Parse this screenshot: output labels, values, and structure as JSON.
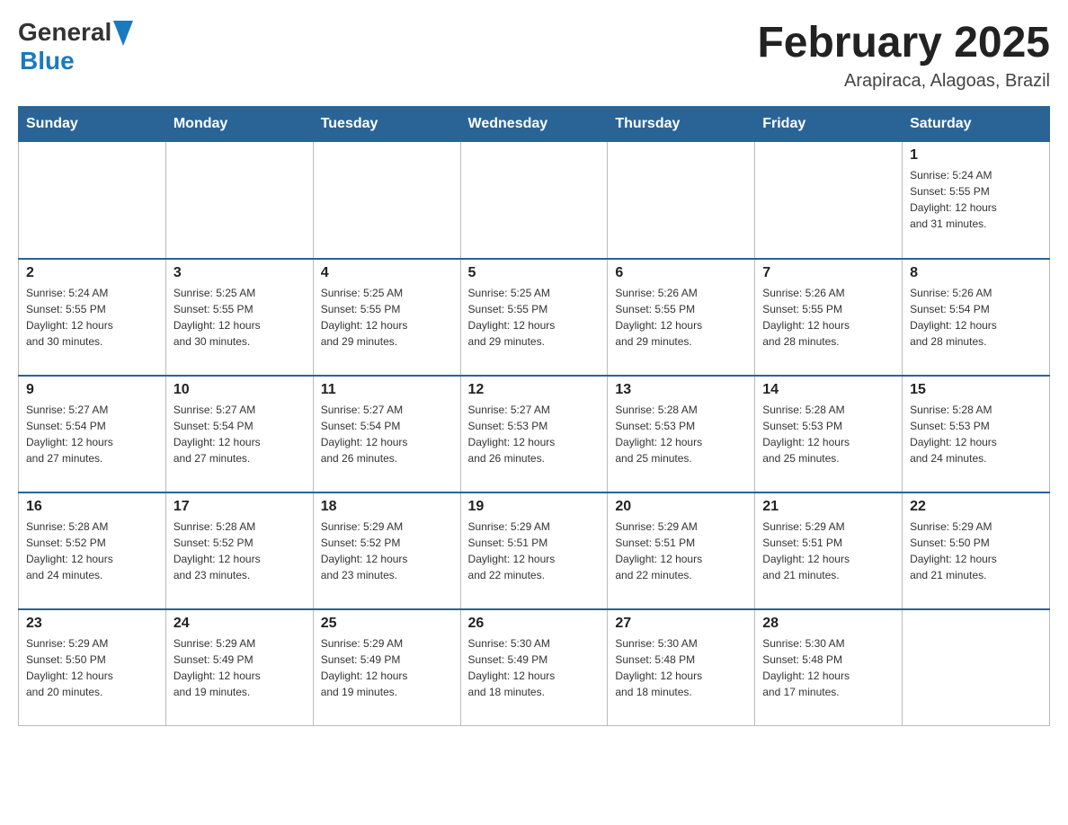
{
  "header": {
    "logo_general": "General",
    "logo_blue": "Blue",
    "main_title": "February 2025",
    "subtitle": "Arapiraca, Alagoas, Brazil"
  },
  "weekdays": [
    "Sunday",
    "Monday",
    "Tuesday",
    "Wednesday",
    "Thursday",
    "Friday",
    "Saturday"
  ],
  "weeks": [
    [
      {
        "day": "",
        "info": ""
      },
      {
        "day": "",
        "info": ""
      },
      {
        "day": "",
        "info": ""
      },
      {
        "day": "",
        "info": ""
      },
      {
        "day": "",
        "info": ""
      },
      {
        "day": "",
        "info": ""
      },
      {
        "day": "1",
        "info": "Sunrise: 5:24 AM\nSunset: 5:55 PM\nDaylight: 12 hours\nand 31 minutes."
      }
    ],
    [
      {
        "day": "2",
        "info": "Sunrise: 5:24 AM\nSunset: 5:55 PM\nDaylight: 12 hours\nand 30 minutes."
      },
      {
        "day": "3",
        "info": "Sunrise: 5:25 AM\nSunset: 5:55 PM\nDaylight: 12 hours\nand 30 minutes."
      },
      {
        "day": "4",
        "info": "Sunrise: 5:25 AM\nSunset: 5:55 PM\nDaylight: 12 hours\nand 29 minutes."
      },
      {
        "day": "5",
        "info": "Sunrise: 5:25 AM\nSunset: 5:55 PM\nDaylight: 12 hours\nand 29 minutes."
      },
      {
        "day": "6",
        "info": "Sunrise: 5:26 AM\nSunset: 5:55 PM\nDaylight: 12 hours\nand 29 minutes."
      },
      {
        "day": "7",
        "info": "Sunrise: 5:26 AM\nSunset: 5:55 PM\nDaylight: 12 hours\nand 28 minutes."
      },
      {
        "day": "8",
        "info": "Sunrise: 5:26 AM\nSunset: 5:54 PM\nDaylight: 12 hours\nand 28 minutes."
      }
    ],
    [
      {
        "day": "9",
        "info": "Sunrise: 5:27 AM\nSunset: 5:54 PM\nDaylight: 12 hours\nand 27 minutes."
      },
      {
        "day": "10",
        "info": "Sunrise: 5:27 AM\nSunset: 5:54 PM\nDaylight: 12 hours\nand 27 minutes."
      },
      {
        "day": "11",
        "info": "Sunrise: 5:27 AM\nSunset: 5:54 PM\nDaylight: 12 hours\nand 26 minutes."
      },
      {
        "day": "12",
        "info": "Sunrise: 5:27 AM\nSunset: 5:53 PM\nDaylight: 12 hours\nand 26 minutes."
      },
      {
        "day": "13",
        "info": "Sunrise: 5:28 AM\nSunset: 5:53 PM\nDaylight: 12 hours\nand 25 minutes."
      },
      {
        "day": "14",
        "info": "Sunrise: 5:28 AM\nSunset: 5:53 PM\nDaylight: 12 hours\nand 25 minutes."
      },
      {
        "day": "15",
        "info": "Sunrise: 5:28 AM\nSunset: 5:53 PM\nDaylight: 12 hours\nand 24 minutes."
      }
    ],
    [
      {
        "day": "16",
        "info": "Sunrise: 5:28 AM\nSunset: 5:52 PM\nDaylight: 12 hours\nand 24 minutes."
      },
      {
        "day": "17",
        "info": "Sunrise: 5:28 AM\nSunset: 5:52 PM\nDaylight: 12 hours\nand 23 minutes."
      },
      {
        "day": "18",
        "info": "Sunrise: 5:29 AM\nSunset: 5:52 PM\nDaylight: 12 hours\nand 23 minutes."
      },
      {
        "day": "19",
        "info": "Sunrise: 5:29 AM\nSunset: 5:51 PM\nDaylight: 12 hours\nand 22 minutes."
      },
      {
        "day": "20",
        "info": "Sunrise: 5:29 AM\nSunset: 5:51 PM\nDaylight: 12 hours\nand 22 minutes."
      },
      {
        "day": "21",
        "info": "Sunrise: 5:29 AM\nSunset: 5:51 PM\nDaylight: 12 hours\nand 21 minutes."
      },
      {
        "day": "22",
        "info": "Sunrise: 5:29 AM\nSunset: 5:50 PM\nDaylight: 12 hours\nand 21 minutes."
      }
    ],
    [
      {
        "day": "23",
        "info": "Sunrise: 5:29 AM\nSunset: 5:50 PM\nDaylight: 12 hours\nand 20 minutes."
      },
      {
        "day": "24",
        "info": "Sunrise: 5:29 AM\nSunset: 5:49 PM\nDaylight: 12 hours\nand 19 minutes."
      },
      {
        "day": "25",
        "info": "Sunrise: 5:29 AM\nSunset: 5:49 PM\nDaylight: 12 hours\nand 19 minutes."
      },
      {
        "day": "26",
        "info": "Sunrise: 5:30 AM\nSunset: 5:49 PM\nDaylight: 12 hours\nand 18 minutes."
      },
      {
        "day": "27",
        "info": "Sunrise: 5:30 AM\nSunset: 5:48 PM\nDaylight: 12 hours\nand 18 minutes."
      },
      {
        "day": "28",
        "info": "Sunrise: 5:30 AM\nSunset: 5:48 PM\nDaylight: 12 hours\nand 17 minutes."
      },
      {
        "day": "",
        "info": ""
      }
    ]
  ]
}
